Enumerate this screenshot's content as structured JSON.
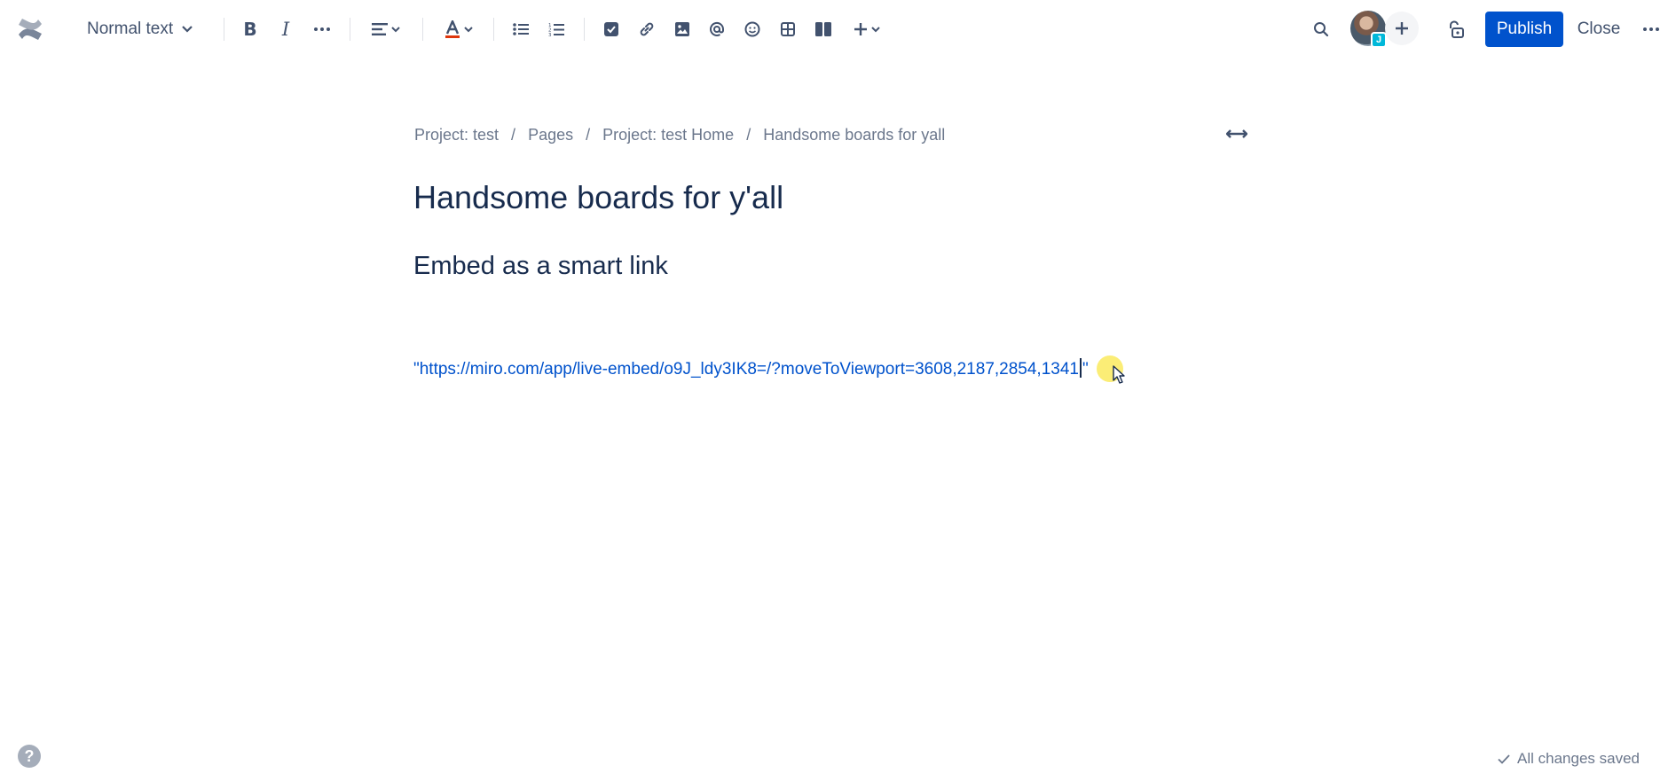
{
  "toolbar": {
    "text_style": "Normal text",
    "bold_label": "B",
    "italic_label": "I",
    "publish_label": "Publish",
    "close_label": "Close",
    "collaborator_badge": "J",
    "icons": [
      "confluence-logo",
      "chevron-down",
      "more-horizontal",
      "align-left",
      "text-color",
      "bullet-list",
      "numbered-list",
      "task",
      "link",
      "image",
      "mention",
      "emoji",
      "table",
      "layout",
      "plus",
      "search",
      "plus",
      "unlock",
      "more-horizontal"
    ]
  },
  "breadcrumb": [
    "Project: test",
    "Pages",
    "Project: test Home",
    "Handsome boards for yall"
  ],
  "breadcrumb_separator": "/",
  "page": {
    "title": "Handsome boards for y'all",
    "heading": "Embed as a smart link",
    "link_text": "\"https://miro.com/app/live-embed/o9J_ldy3IK8=/?moveToViewport=3608,2187,2854,1341",
    "link_text_end": "\""
  },
  "footer": {
    "help_label": "?",
    "save_status": "All changes saved"
  },
  "colors": {
    "primary": "#0052cc",
    "text": "#172b4d",
    "subtle": "#6b778c",
    "link": "#0052cc"
  }
}
